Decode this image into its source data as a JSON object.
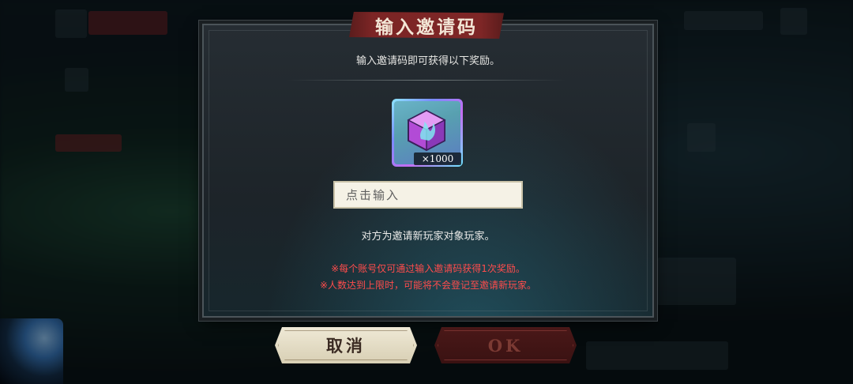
{
  "dialog": {
    "title": "输入邀请码",
    "subtitle": "输入邀请码即可获得以下奖励。",
    "reward": {
      "icon": "crystal-cube-icon",
      "quantity": "×1000"
    },
    "code_input": {
      "value": "",
      "placeholder": "点击输入"
    },
    "note": "对方为邀请新玩家对象玩家。",
    "warnings": [
      "※每个账号仅可通过输入邀请码获得1次奖励。",
      "※人数达到上限时，可能将不会登记至邀请新玩家。"
    ],
    "buttons": {
      "cancel": "取消",
      "ok": "OK"
    }
  },
  "colors": {
    "title_banner": "#7c2525",
    "warning_text": "#ff4c4c",
    "cancel_button": "#e6dfc7",
    "ok_button": "#4a1818"
  }
}
